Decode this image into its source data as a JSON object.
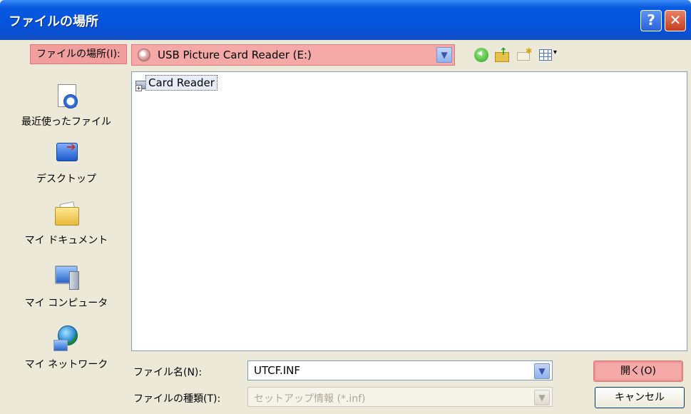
{
  "window": {
    "title": "ファイルの場所",
    "help_glyph": "?",
    "close_glyph": "✕"
  },
  "toolbar": {
    "lookin_label": "ファイルの場所(I):",
    "lookin_value": "USB Picture Card Reader (E:)",
    "icons": [
      "back-icon",
      "up-folder-icon",
      "new-folder-icon",
      "views-menu-icon"
    ]
  },
  "places": [
    {
      "label": "最近使ったファイル",
      "icon": "recent-files-icon"
    },
    {
      "label": "デスクトップ",
      "icon": "desktop-icon"
    },
    {
      "label": "マイ ドキュメント",
      "icon": "my-documents-icon"
    },
    {
      "label": "マイ コンピュータ",
      "icon": "my-computer-icon"
    },
    {
      "label": "マイ ネットワーク",
      "icon": "my-network-icon"
    }
  ],
  "files": [
    {
      "name": "Card Reader",
      "icon": "device-icon",
      "selected": true
    }
  ],
  "footer": {
    "filename_label": "ファイル名(N):",
    "filename_value": "UTCF.INF",
    "filetype_label": "ファイルの種類(T):",
    "filetype_value": "セットアップ情報 (*.inf)",
    "open_button": "開く(O)",
    "cancel_button": "キャンセル"
  },
  "colors": {
    "titlebar": "#0553dc",
    "dialog_bg": "#ece9d8",
    "highlight": "#f4a8a8"
  }
}
